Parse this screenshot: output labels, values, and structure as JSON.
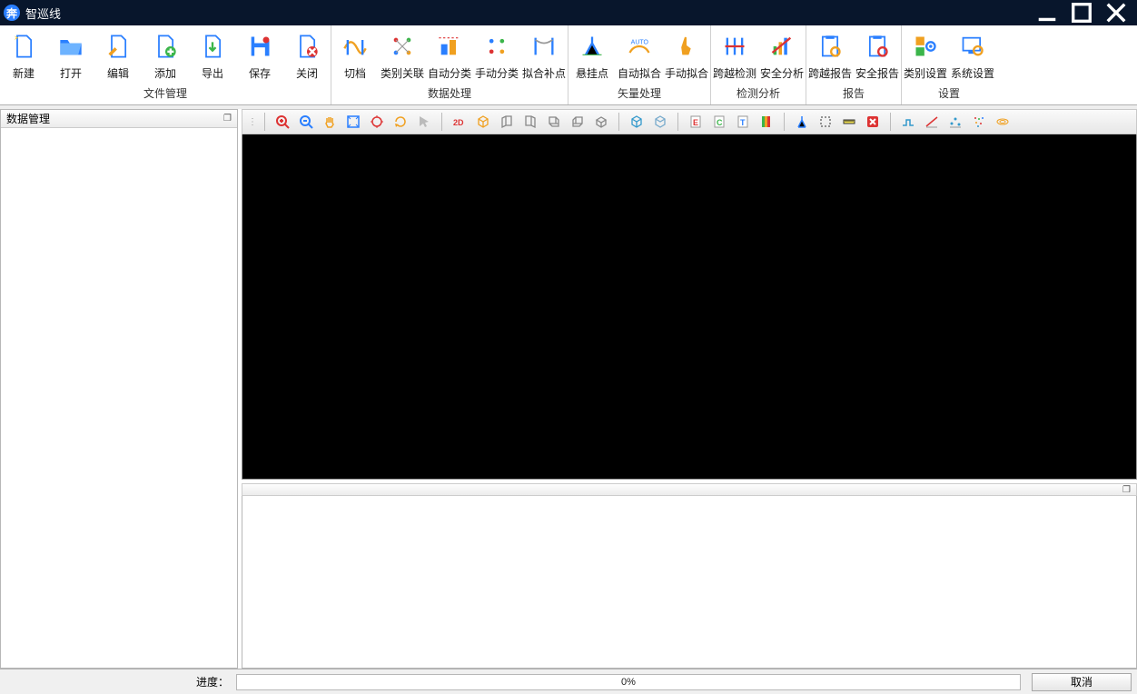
{
  "app": {
    "title": "智巡线",
    "icon_letter": "奔"
  },
  "ribbon": {
    "groups": [
      {
        "label": "文件管理",
        "items": [
          "新建",
          "打开",
          "编辑",
          "添加",
          "导出",
          "保存",
          "关闭"
        ]
      },
      {
        "label": "数据处理",
        "items": [
          "切档",
          "类别关联",
          "自动分类",
          "手动分类",
          "拟合补点"
        ]
      },
      {
        "label": "矢量处理",
        "items": [
          "悬挂点",
          "自动拟合",
          "手动拟合"
        ]
      },
      {
        "label": "检测分析",
        "items": [
          "跨越检测",
          "安全分析"
        ]
      },
      {
        "label": "报告",
        "items": [
          "跨越报告",
          "安全报告"
        ]
      },
      {
        "label": "设置",
        "items": [
          "类别设置",
          "系统设置"
        ]
      }
    ]
  },
  "sidepanel": {
    "title": "数据管理"
  },
  "status": {
    "label": "进度：",
    "percent": "0%",
    "cancel": "取消"
  }
}
